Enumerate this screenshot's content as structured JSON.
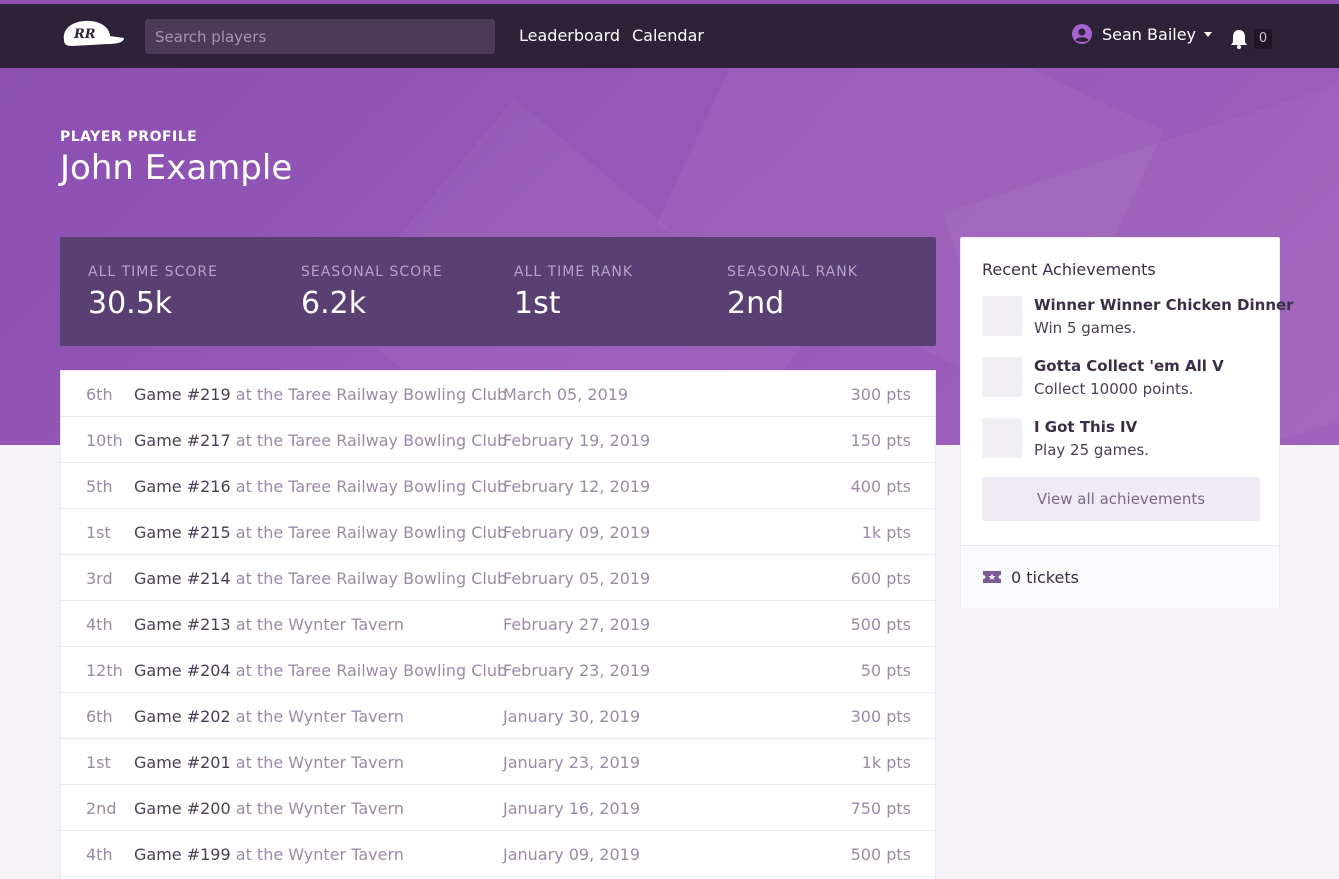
{
  "nav": {
    "logo_text": "RR",
    "search_placeholder": "Search players",
    "links": [
      "Leaderboard",
      "Calendar"
    ],
    "user_name": "Sean Bailey",
    "notification_count": "0"
  },
  "profile": {
    "eyebrow": "PLAYER PROFILE",
    "name": "John Example"
  },
  "stats": [
    {
      "label": "ALL TIME SCORE",
      "value": "30.5k"
    },
    {
      "label": "SEASONAL SCORE",
      "value": "6.2k"
    },
    {
      "label": "ALL TIME RANK",
      "value": "1st"
    },
    {
      "label": "SEASONAL RANK",
      "value": "2nd"
    }
  ],
  "games": [
    {
      "rank": "6th",
      "game": "Game #219",
      "venue": " at the Taree Railway Bowling Club",
      "date": "March 05, 2019",
      "points": "300 pts"
    },
    {
      "rank": "10th",
      "game": "Game #217",
      "venue": " at the Taree Railway Bowling Club",
      "date": "February 19, 2019",
      "points": "150 pts"
    },
    {
      "rank": "5th",
      "game": "Game #216",
      "venue": " at the Taree Railway Bowling Club",
      "date": "February 12, 2019",
      "points": "400 pts"
    },
    {
      "rank": "1st",
      "game": "Game #215",
      "venue": " at the Taree Railway Bowling Club",
      "date": "February 09, 2019",
      "points": "1k pts"
    },
    {
      "rank": "3rd",
      "game": "Game #214",
      "venue": " at the Taree Railway Bowling Club",
      "date": "February 05, 2019",
      "points": "600 pts"
    },
    {
      "rank": "4th",
      "game": "Game #213",
      "venue": " at the Wynter Tavern",
      "date": "February 27, 2019",
      "points": "500 pts"
    },
    {
      "rank": "12th",
      "game": "Game #204",
      "venue": " at the Taree Railway Bowling Club",
      "date": "February 23, 2019",
      "points": "50 pts"
    },
    {
      "rank": "6th",
      "game": "Game #202",
      "venue": " at the Wynter Tavern",
      "date": "January 30, 2019",
      "points": "300 pts"
    },
    {
      "rank": "1st",
      "game": "Game #201",
      "venue": " at the Wynter Tavern",
      "date": "January 23, 2019",
      "points": "1k pts"
    },
    {
      "rank": "2nd",
      "game": "Game #200",
      "venue": " at the Wynter Tavern",
      "date": "January 16, 2019",
      "points": "750 pts"
    },
    {
      "rank": "4th",
      "game": "Game #199",
      "venue": " at the Wynter Tavern",
      "date": "January 09, 2019",
      "points": "500 pts"
    }
  ],
  "achievements": {
    "title": "Recent Achievements",
    "items": [
      {
        "name": "Winner Winner Chicken Dinner",
        "description": "Win 5 games."
      },
      {
        "name": "Gotta Collect 'em All V",
        "description": "Collect 10000 points."
      },
      {
        "name": "I Got This IV",
        "description": "Play 25 games."
      }
    ],
    "view_all_label": "View all achievements"
  },
  "tickets_label": "0 tickets",
  "colors": {
    "brand_purple": "#8f4fb4",
    "topbar": "#2e2238",
    "stats_panel": "#5a3f72"
  }
}
